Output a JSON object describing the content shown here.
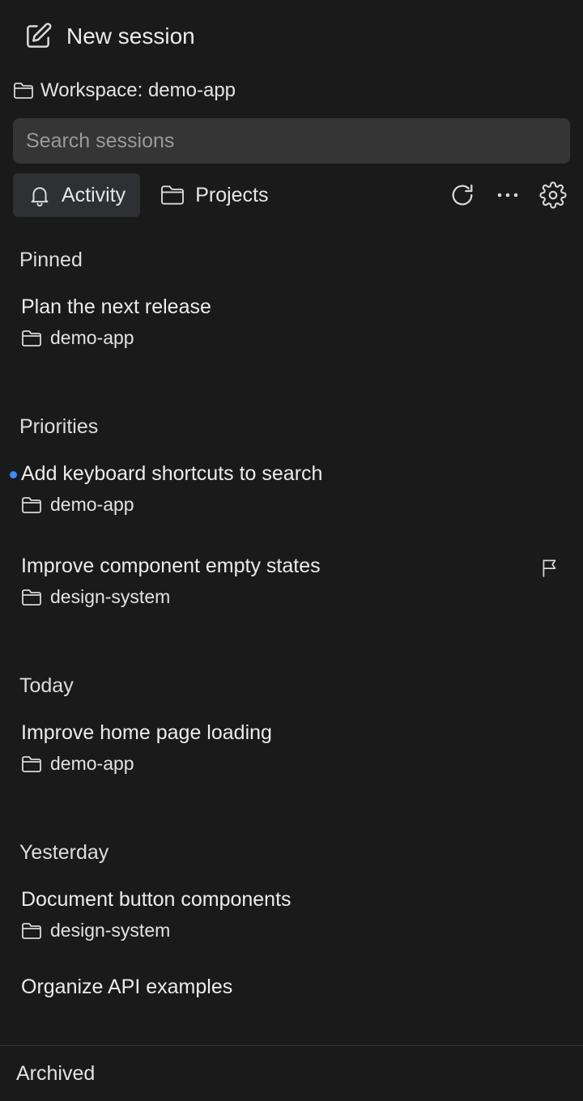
{
  "header": {
    "new_session_label": "New session",
    "new_session_icon": "edit-icon",
    "workspace_label": "Workspace: demo-app",
    "workspace_icon": "folder-icon"
  },
  "search": {
    "placeholder": "Search sessions",
    "value": ""
  },
  "tabs": [
    {
      "label": "Activity",
      "icon": "bell-icon",
      "active": true
    },
    {
      "label": "Projects",
      "icon": "folder-icon",
      "active": false
    }
  ],
  "toolbar": {
    "icons": [
      "refresh-icon",
      "more-icon",
      "settings-icon"
    ]
  },
  "sections": {
    "pinned": {
      "title": "Pinned",
      "items": [
        {
          "title": "Plan the next release",
          "project": "demo-app"
        }
      ]
    },
    "priorities": {
      "title": "Priorities",
      "items": [
        {
          "title": "Add keyboard shortcuts to search",
          "project": "demo-app",
          "unread": true
        },
        {
          "title": "Improve component empty states",
          "project": "design-system",
          "flag": "flag-icon"
        }
      ]
    },
    "today": {
      "title": "Today",
      "items": [
        {
          "title": "Improve home page loading",
          "project": "demo-app"
        }
      ]
    },
    "yesterday": {
      "title": "Yesterday",
      "items": [
        {
          "title": "Document button components",
          "project": "design-system"
        },
        {
          "title": "Organize API examples"
        }
      ]
    }
  },
  "footer": {
    "archived_label": "Archived"
  },
  "colors": {
    "background": "#1a1a1a",
    "unread_dot": "#3b8cf5",
    "search_bg": "#353535",
    "tab_active_bg": "#2f3033"
  }
}
